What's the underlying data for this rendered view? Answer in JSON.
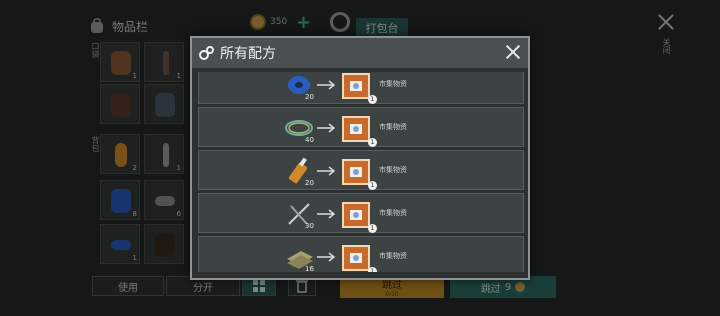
{
  "inventory": {
    "title": "物品栏",
    "coins": "350",
    "pack_tab": "打包台",
    "side_label_1": "口袋",
    "side_label_2": "背包",
    "slot_counts": [
      "1",
      "1",
      "2",
      "1",
      "8",
      "6",
      "1"
    ]
  },
  "right_close_label": "关闭",
  "bottom": {
    "use": "使用",
    "split": "分开",
    "skip1_label": "跳过",
    "skip1_sub": "0/10",
    "skip2_label": "跳过",
    "skip2_count": "9"
  },
  "modal": {
    "title": "所有配方",
    "recipes": [
      {
        "ingredient_icon": "tape-icon",
        "ingredient_count": "20",
        "result_icon": "crate-icon",
        "result_count": "1",
        "label": "市集物资"
      },
      {
        "ingredient_icon": "wire-coil-icon",
        "ingredient_count": "40",
        "result_icon": "crate-icon",
        "result_count": "1",
        "label": "市集物资"
      },
      {
        "ingredient_icon": "glue-icon",
        "ingredient_count": "20",
        "result_icon": "crate-icon",
        "result_count": "1",
        "label": "市集物资"
      },
      {
        "ingredient_icon": "scissors-icon",
        "ingredient_count": "30",
        "result_icon": "crate-icon",
        "result_count": "1",
        "label": "市集物资"
      },
      {
        "ingredient_icon": "cloth-icon",
        "ingredient_count": "16",
        "result_icon": "crate-icon",
        "result_count": "1",
        "label": "市集物资"
      }
    ]
  },
  "colors": {
    "accent_teal": "#2c6c64",
    "accent_gold": "#bf8b24",
    "panel": "#2c3030",
    "header": "#4a4f4f"
  }
}
